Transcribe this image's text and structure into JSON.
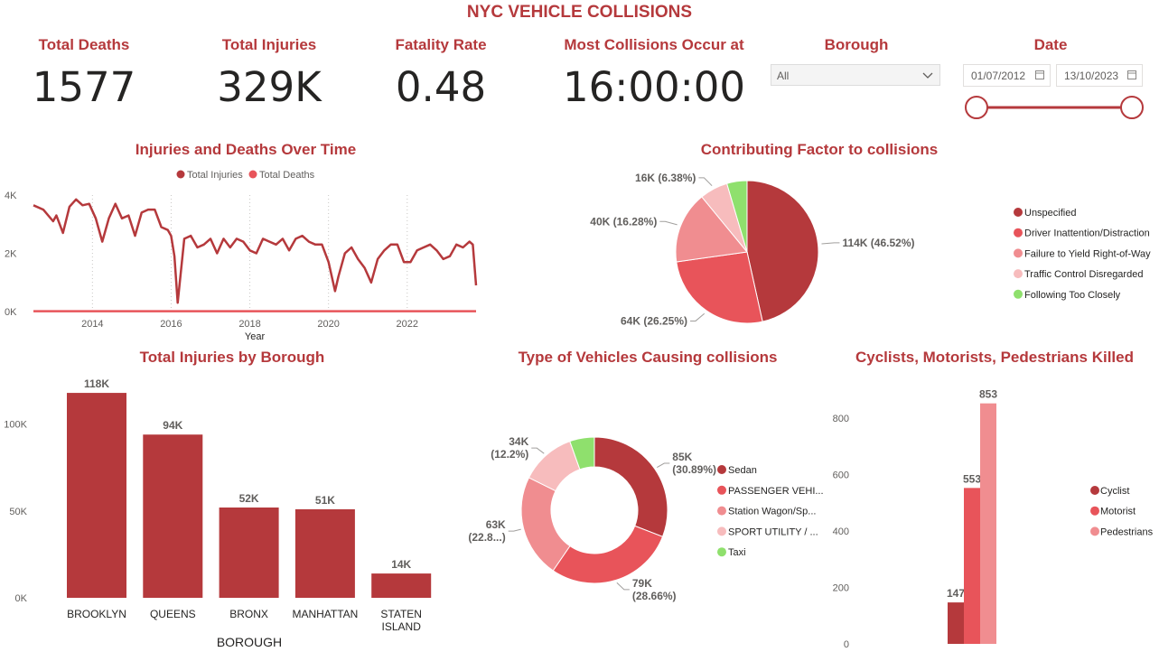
{
  "dashboard_title": "NYC VEHICLE COLLISIONS",
  "cards": [
    {
      "label": "Total Deaths",
      "value": "1577"
    },
    {
      "label": "Total Injuries",
      "value": "329K"
    },
    {
      "label": "Fatality Rate",
      "value": "0.48"
    },
    {
      "label": "Most Collisions Occur at",
      "value": "16:00:00"
    }
  ],
  "filters": {
    "borough_label": "Borough",
    "borough_value": "All",
    "date_label": "Date",
    "date_start": "01/07/2012",
    "date_end": "13/10/2023",
    "date_range_fraction": [
      0,
      1
    ]
  },
  "colors": {
    "dark_red": "#b5393c",
    "red": "#e8545a",
    "pink": "#f08d90",
    "light_pink": "#f7bcbd",
    "green": "#8fe06d",
    "title": "#b5393c"
  },
  "chart_data": [
    {
      "type": "line",
      "title": "Injuries and Deaths Over Time",
      "xlabel": "Year",
      "ylabel": "",
      "x_ticks": [
        "2014",
        "2016",
        "2018",
        "2020",
        "2022"
      ],
      "y_ticks": [
        "0K",
        "2K",
        "4K"
      ],
      "ylim": [
        0,
        4000
      ],
      "xlim": [
        "2012-07",
        "2023-10"
      ],
      "legend": [
        "Total Injuries",
        "Total Deaths"
      ],
      "series": [
        {
          "name": "Total Injuries",
          "x": [
            "2012-07",
            "2012-10",
            "2013-01",
            "2013-02",
            "2013-04",
            "2013-06",
            "2013-08",
            "2013-10",
            "2013-12",
            "2014-02",
            "2014-04",
            "2014-06",
            "2014-08",
            "2014-10",
            "2014-12",
            "2015-02",
            "2015-04",
            "2015-06",
            "2015-08",
            "2015-10",
            "2015-12",
            "2016-01",
            "2016-02",
            "2016-03",
            "2016-05",
            "2016-07",
            "2016-09",
            "2016-11",
            "2017-01",
            "2017-03",
            "2017-05",
            "2017-07",
            "2017-09",
            "2017-11",
            "2018-01",
            "2018-03",
            "2018-05",
            "2018-07",
            "2018-09",
            "2018-11",
            "2019-01",
            "2019-03",
            "2019-05",
            "2019-07",
            "2019-09",
            "2019-11",
            "2020-01",
            "2020-03",
            "2020-04",
            "2020-06",
            "2020-08",
            "2020-10",
            "2020-12",
            "2021-02",
            "2021-04",
            "2021-06",
            "2021-08",
            "2021-10",
            "2021-12",
            "2022-02",
            "2022-04",
            "2022-06",
            "2022-08",
            "2022-10",
            "2022-12",
            "2023-02",
            "2023-04",
            "2023-06",
            "2023-08",
            "2023-09",
            "2023-10"
          ],
          "values": [
            3650,
            3500,
            3100,
            3300,
            2700,
            3600,
            3850,
            3650,
            3700,
            3200,
            2400,
            3200,
            3700,
            3200,
            3300,
            2600,
            3400,
            3500,
            3500,
            2900,
            2800,
            2600,
            1900,
            300,
            2500,
            2600,
            2200,
            2300,
            2500,
            2000,
            2500,
            2200,
            2500,
            2400,
            2100,
            2000,
            2500,
            2400,
            2300,
            2500,
            2100,
            2500,
            2600,
            2400,
            2300,
            2300,
            1700,
            700,
            1200,
            2000,
            2200,
            1800,
            1500,
            1000,
            1800,
            2100,
            2300,
            2300,
            1700,
            1700,
            2100,
            2200,
            2300,
            2100,
            1800,
            1900,
            2300,
            2200,
            2400,
            2300,
            900
          ]
        },
        {
          "name": "Total Deaths",
          "x": [
            "2012-07",
            "2023-10"
          ],
          "values": [
            12,
            12
          ]
        }
      ]
    },
    {
      "type": "pie",
      "title": "Contributing Factor to collisions",
      "legend": [
        "Unspecified",
        "Driver Inattention/Distraction",
        "Failure to Yield Right-of-Way",
        "Traffic Control Disregarded",
        "Following Too Closely"
      ],
      "values": [
        46.52,
        26.25,
        16.28,
        6.38,
        4.57
      ],
      "labels": [
        "114K (46.52%)",
        "64K (26.25%)",
        "40K (16.28%)",
        "16K (6.38%)",
        ""
      ]
    },
    {
      "type": "bar",
      "title": "Total Injuries by Borough",
      "xlabel": "BOROUGH",
      "ylabel": "",
      "categories": [
        "BROOKLYN",
        "QUEENS",
        "BRONX",
        "MANHATTAN",
        "STATEN ISLAND"
      ],
      "values": [
        118000,
        94000,
        52000,
        51000,
        14000
      ],
      "data_labels": [
        "118K",
        "94K",
        "52K",
        "51K",
        "14K"
      ],
      "y_ticks": [
        "0K",
        "50K",
        "100K"
      ],
      "ylim": [
        0,
        130000
      ]
    },
    {
      "type": "pie",
      "title": "Type of Vehicles Causing collisions",
      "donut": true,
      "legend": [
        "Sedan",
        "PASSENGER VEHI...",
        "Station Wagon/Sp...",
        "SPORT UTILITY / ...",
        "Taxi"
      ],
      "values": [
        30.89,
        28.66,
        22.8,
        12.2,
        5.45
      ],
      "labels": [
        [
          "85K",
          "(30.89%)"
        ],
        [
          "79K",
          "(28.66%)"
        ],
        [
          "63K",
          "(22.8...)"
        ],
        [
          "34K",
          "(12.2%)"
        ],
        [
          "",
          ""
        ]
      ]
    },
    {
      "type": "bar",
      "title": "Cyclists, Motorists, Pedestrians Killed",
      "categories": [
        "Cyclist",
        "Motorist",
        "Pedestrians"
      ],
      "legend": [
        "Cyclist",
        "Motorist",
        "Pedestrians"
      ],
      "values": [
        147,
        553,
        853
      ],
      "data_labels": [
        "147",
        "553",
        "853"
      ],
      "y_ticks": [
        "0",
        "200",
        "400",
        "600",
        "800"
      ],
      "ylim": [
        0,
        900
      ]
    }
  ]
}
